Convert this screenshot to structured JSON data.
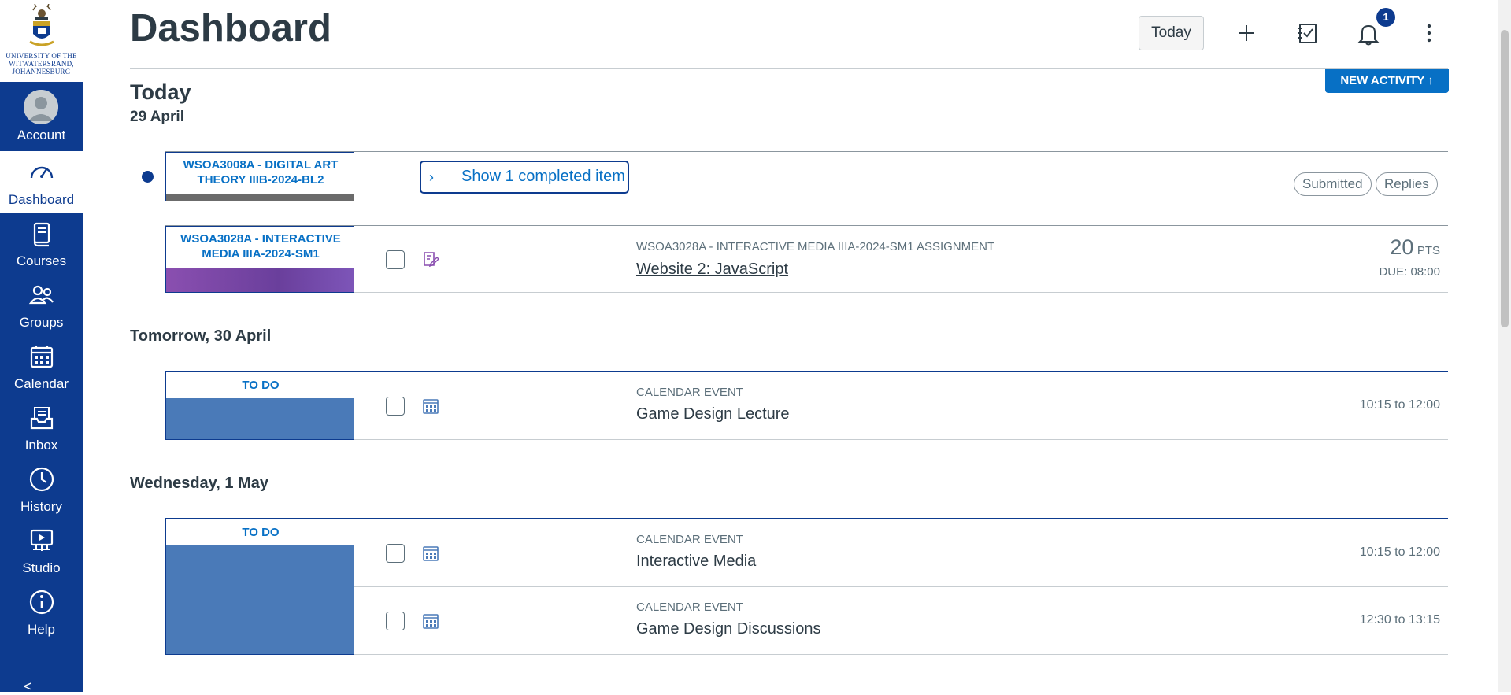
{
  "nav": {
    "logo_text": [
      "UNIVERSITY OF THE",
      "WITWATERSRAND,",
      "JOHANNESBURG"
    ],
    "items": [
      {
        "label": "Account",
        "icon": "user-icon"
      },
      {
        "label": "Dashboard",
        "icon": "dashboard-icon"
      },
      {
        "label": "Courses",
        "icon": "book-icon"
      },
      {
        "label": "Groups",
        "icon": "groups-icon"
      },
      {
        "label": "Calendar",
        "icon": "calendar-icon"
      },
      {
        "label": "Inbox",
        "icon": "inbox-icon"
      },
      {
        "label": "History",
        "icon": "clock-icon"
      },
      {
        "label": "Studio",
        "icon": "studio-icon"
      },
      {
        "label": "Help",
        "icon": "info-icon"
      }
    ],
    "collapse": "<",
    "colors": {
      "background": "#0d3b8f",
      "active_background": "#ffffff"
    }
  },
  "header": {
    "title": "Dashboard",
    "today_button": "Today",
    "notification_count": "1",
    "icons": [
      "plus-icon",
      "todo-list-icon",
      "bell-icon",
      "kebab-menu-icon"
    ]
  },
  "new_activity": "NEW ACTIVITY ↑",
  "today": {
    "heading": "Today",
    "date": "29 April",
    "completed_group": {
      "course": "WSOA3008A - DIGITAL ART THEORY IIIB-2024-BL2",
      "show_completed": "Show 1 completed item",
      "pills": [
        "Submitted",
        "Replies"
      ]
    },
    "assignment": {
      "course": "WSOA3028A - INTERACTIVE MEDIA IIIA-2024-SM1",
      "type": "WSOA3028A - INTERACTIVE MEDIA IIIA-2024-SM1 ASSIGNMENT",
      "title": "Website 2: JavaScript",
      "points": "20",
      "points_unit": "PTS",
      "due": "DUE: 08:00"
    }
  },
  "tomorrow": {
    "heading": "Tomorrow, 30 April",
    "tag": "TO DO",
    "items": [
      {
        "type": "CALENDAR EVENT",
        "title": "Game Design Lecture",
        "time": "10:15 to 12:00"
      }
    ]
  },
  "wednesday": {
    "heading": "Wednesday, 1 May",
    "tag": "TO DO",
    "items": [
      {
        "type": "CALENDAR EVENT",
        "title": "Interactive Media",
        "time": "10:15 to 12:00"
      },
      {
        "type": "CALENDAR EVENT",
        "title": "Game Design Discussions",
        "time": "12:30 to 13:15"
      }
    ]
  },
  "colors": {
    "accent": "#0770c5",
    "todo_block": "#4a7ab8",
    "text": "#2d3b45",
    "muted": "#5c6f7a"
  }
}
